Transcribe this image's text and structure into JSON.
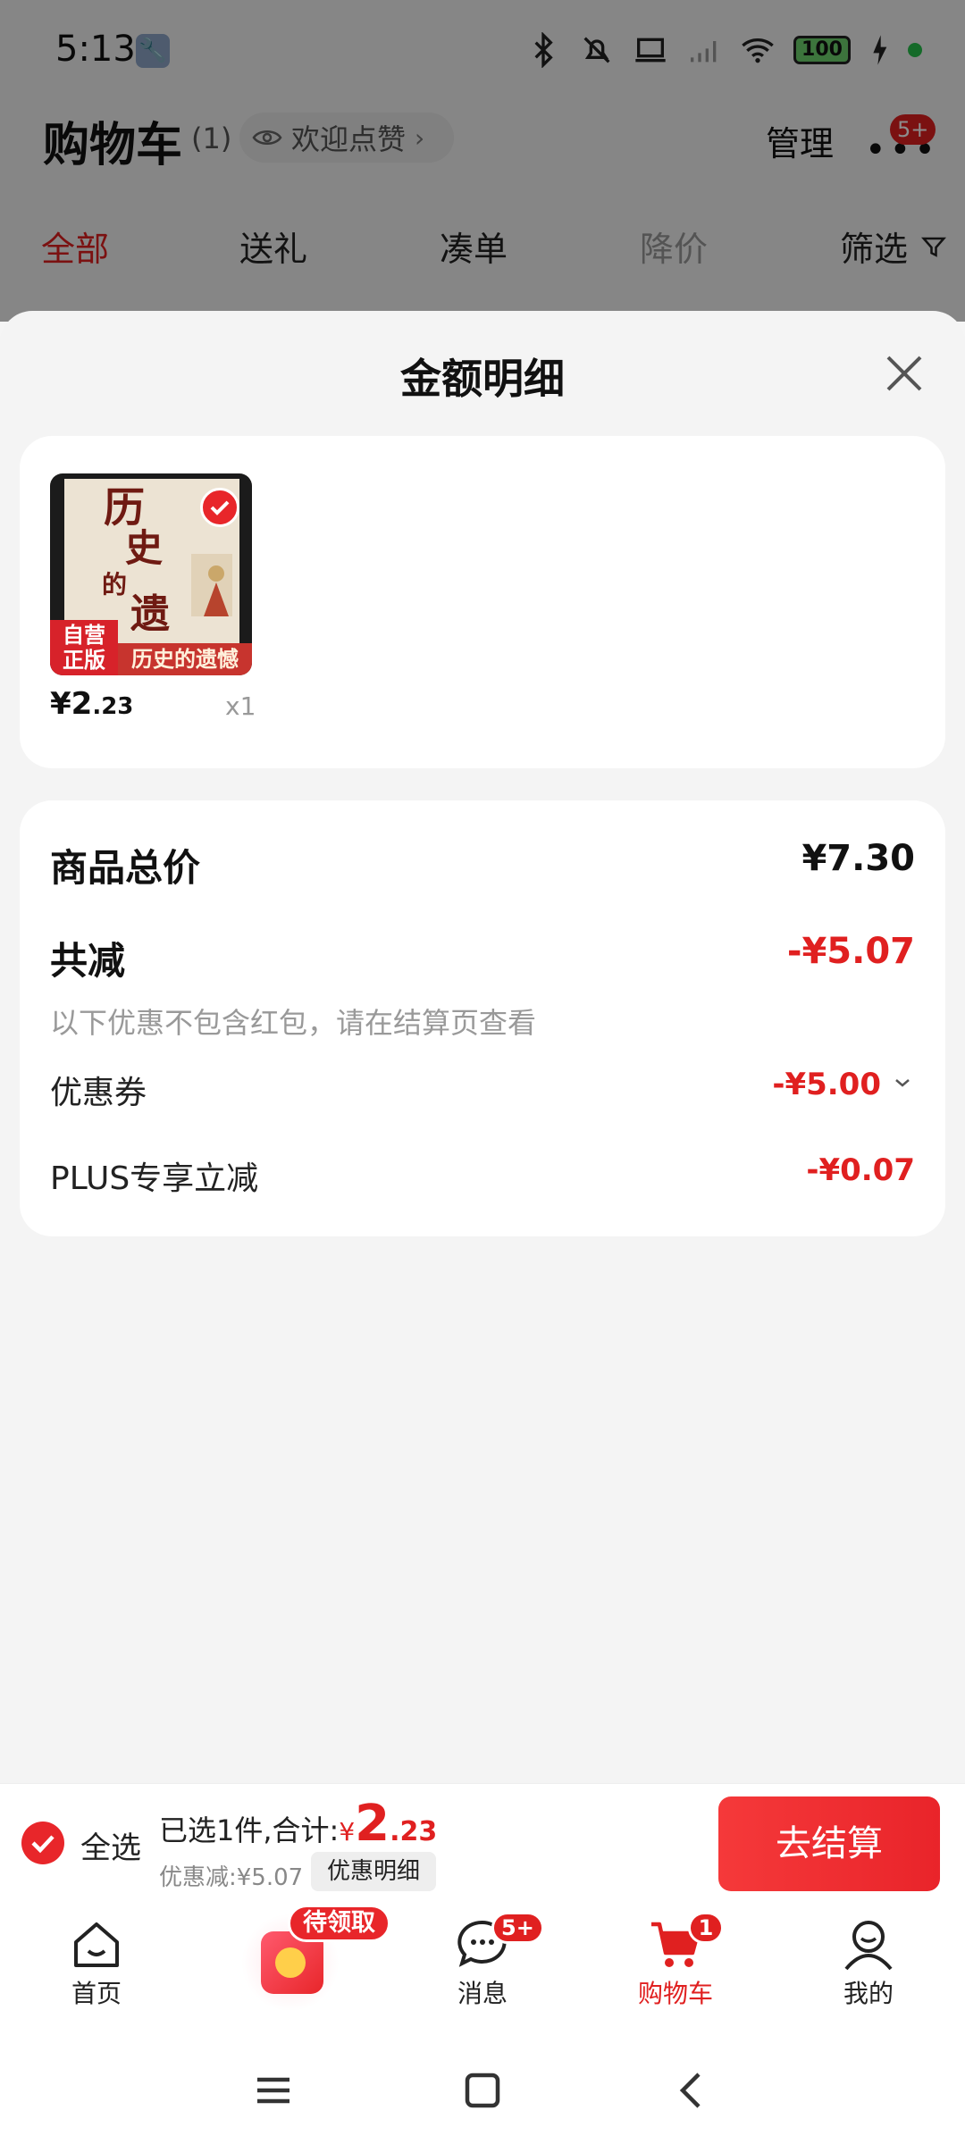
{
  "status_bar": {
    "time": "5:13",
    "battery": "100"
  },
  "header": {
    "title": "购物车",
    "count": "(1)",
    "like_text": "欢迎点赞",
    "manage": "管理",
    "more_badge": "5+"
  },
  "filter_tabs": [
    {
      "label": "全部"
    },
    {
      "label": "送礼"
    },
    {
      "label": "凑单"
    },
    {
      "label": "降价"
    },
    {
      "label": "筛选"
    }
  ],
  "sheet": {
    "title": "金额明细",
    "product": {
      "cover_title": "历史的遗憾",
      "tag": "自营正版",
      "price_yen": "¥",
      "price_int": "2",
      "price_dec": ".23",
      "qty": "x1"
    },
    "details": {
      "total_label": "商品总价",
      "total_value": "¥7.30",
      "reduce_label": "共减",
      "reduce_value": "-¥5.07",
      "note": "以下优惠不包含红包，请在结算页查看",
      "coupon_label": "优惠券",
      "coupon_value": "-¥5.00",
      "plus_label": "PLUS专享立减",
      "plus_value": "-¥0.07"
    }
  },
  "checkout": {
    "select_all": "全选",
    "summary_prefix": "已选1件,合计:",
    "sum_yen": "¥",
    "sum_int": "2",
    "sum_dec": ".23",
    "discount": "优惠减:¥5.07",
    "detail_chip": "优惠明细",
    "button": "去结算"
  },
  "bottom_nav": {
    "home": "首页",
    "promo_tag": "待领取",
    "messages": "消息",
    "messages_badge": "5+",
    "cart": "购物车",
    "cart_badge": "1",
    "me": "我的"
  },
  "colors": {
    "accent": "#e02020",
    "overlay": "rgba(0,0,0,0.45)"
  }
}
